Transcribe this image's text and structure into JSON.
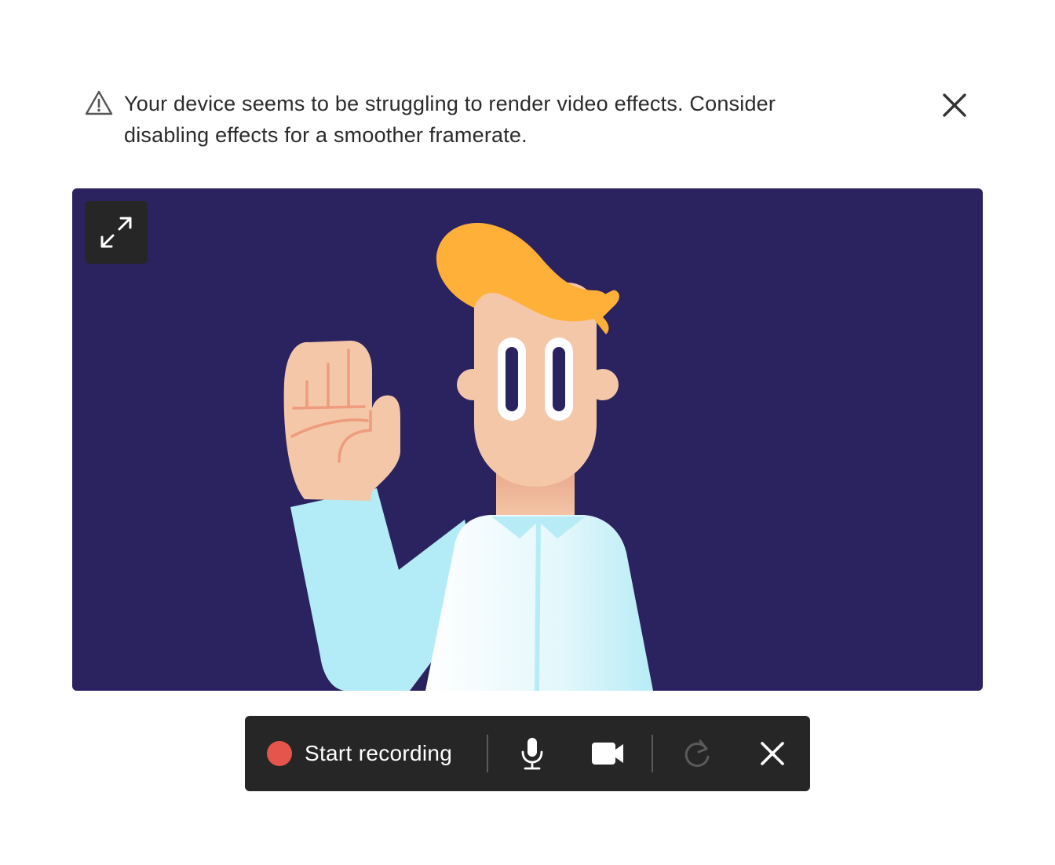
{
  "warning": {
    "icon": "warning-triangle-icon",
    "message": "Your device seems to be struggling to render video effects. Consider disabling effects for a smoother framerate.",
    "close_icon": "close-icon"
  },
  "video": {
    "background_color": "#2b2260",
    "expand_icon": "expand-icon"
  },
  "toolbar": {
    "record_label": "Start recording",
    "record_color": "#e5554b",
    "icons": [
      "record-dot-icon",
      "microphone-icon",
      "camera-icon",
      "retake-icon",
      "close-icon"
    ]
  }
}
